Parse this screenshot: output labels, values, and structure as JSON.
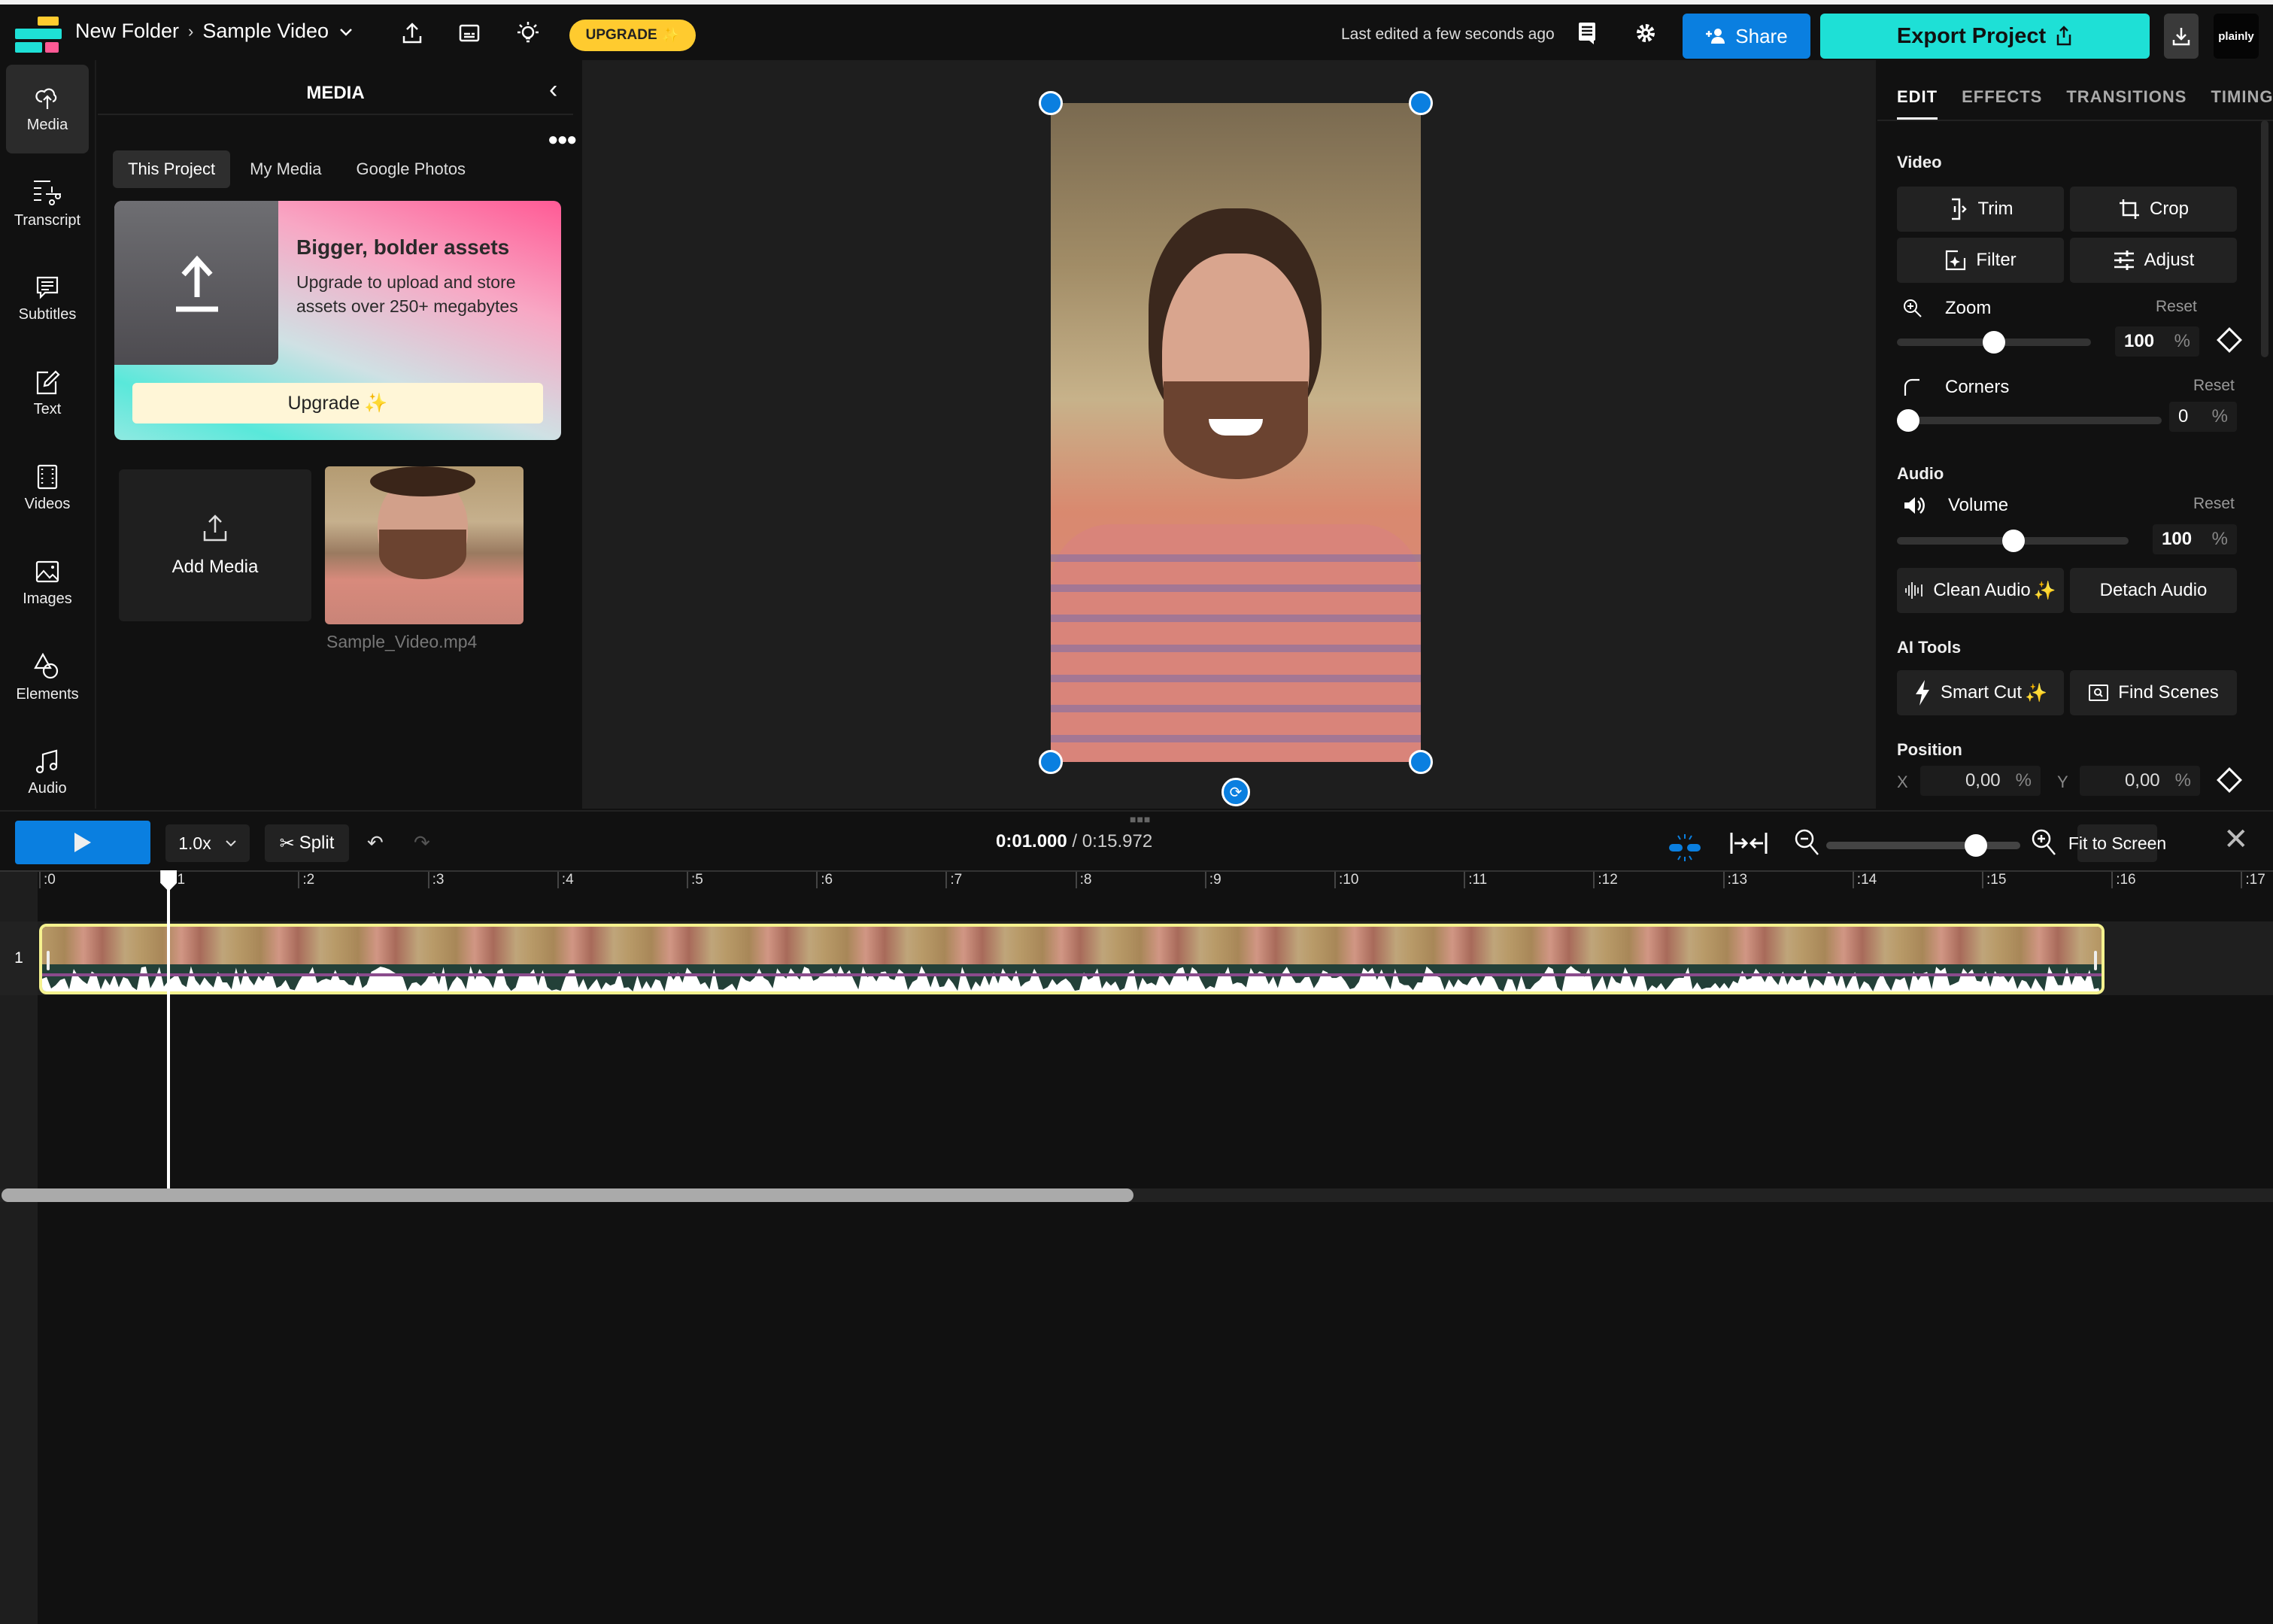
{
  "topbar": {
    "breadcrumb_folder": "New Folder",
    "breadcrumb_sep": "›",
    "project_name": "Sample Video",
    "upgrade_label": "UPGRADE",
    "last_edited": "Last edited a few seconds ago",
    "share_label": "Share",
    "export_label": "Export Project",
    "brand_label": "plainly",
    "colors": {
      "accent_blue": "#0a7fe0",
      "export_teal": "#1ee0d6",
      "upgrade_yellow": "#ffcb2f"
    }
  },
  "leftnav": {
    "items": [
      {
        "label": "Media",
        "icon": "upload-cloud-icon",
        "active": true
      },
      {
        "label": "Transcript",
        "icon": "transcript-scissors-icon"
      },
      {
        "label": "Subtitles",
        "icon": "subtitles-icon"
      },
      {
        "label": "Text",
        "icon": "text-edit-icon"
      },
      {
        "label": "Videos",
        "icon": "film-icon"
      },
      {
        "label": "Images",
        "icon": "image-icon"
      },
      {
        "label": "Elements",
        "icon": "shapes-icon"
      },
      {
        "label": "Audio",
        "icon": "music-note-icon"
      }
    ]
  },
  "media_panel": {
    "title": "MEDIA",
    "tabs": [
      "This Project",
      "My Media",
      "Google Photos"
    ],
    "active_tab": "This Project",
    "promo": {
      "title": "Bigger, bolder assets",
      "text": "Upgrade to upload and store assets over 250+ megabytes",
      "button_label": "Upgrade"
    },
    "add_media_label": "Add Media",
    "files": [
      {
        "name": "Sample_Video.mp4"
      }
    ]
  },
  "properties": {
    "tabs": [
      "EDIT",
      "EFFECTS",
      "TRANSITIONS",
      "TIMING"
    ],
    "active_tab": "EDIT",
    "video_section": "Video",
    "video_buttons": [
      "Trim",
      "Crop",
      "Filter",
      "Adjust"
    ],
    "zoom": {
      "label": "Zoom",
      "reset": "Reset",
      "value": "100",
      "unit": "%"
    },
    "corners": {
      "label": "Corners",
      "reset": "Reset",
      "value": "0",
      "unit": "%"
    },
    "audio_section": "Audio",
    "volume": {
      "label": "Volume",
      "reset": "Reset",
      "value": "100",
      "unit": "%"
    },
    "audio_buttons": [
      "Clean Audio",
      "Detach Audio"
    ],
    "ai_section": "AI Tools",
    "ai_buttons": [
      "Smart Cut",
      "Find Scenes"
    ],
    "position_section": "Position",
    "position": {
      "x_label": "X",
      "x_value": "0,00",
      "y_label": "Y",
      "y_value": "0,00",
      "unit": "%"
    }
  },
  "timeline": {
    "speed": "1.0x",
    "split_label": "Split",
    "current_time": "0:01.000",
    "total_time": "/ 0:15.972",
    "fit_label": "Fit to Screen",
    "ruler": [
      ":0",
      ":1",
      ":2",
      ":3",
      ":4",
      ":5",
      ":6",
      ":7",
      ":8",
      ":9",
      ":10",
      ":11",
      ":12",
      ":13",
      ":14",
      ":15",
      ":16",
      ":17"
    ],
    "track_number": "1",
    "playhead_seconds": 1.0,
    "duration_seconds": 15.972
  }
}
